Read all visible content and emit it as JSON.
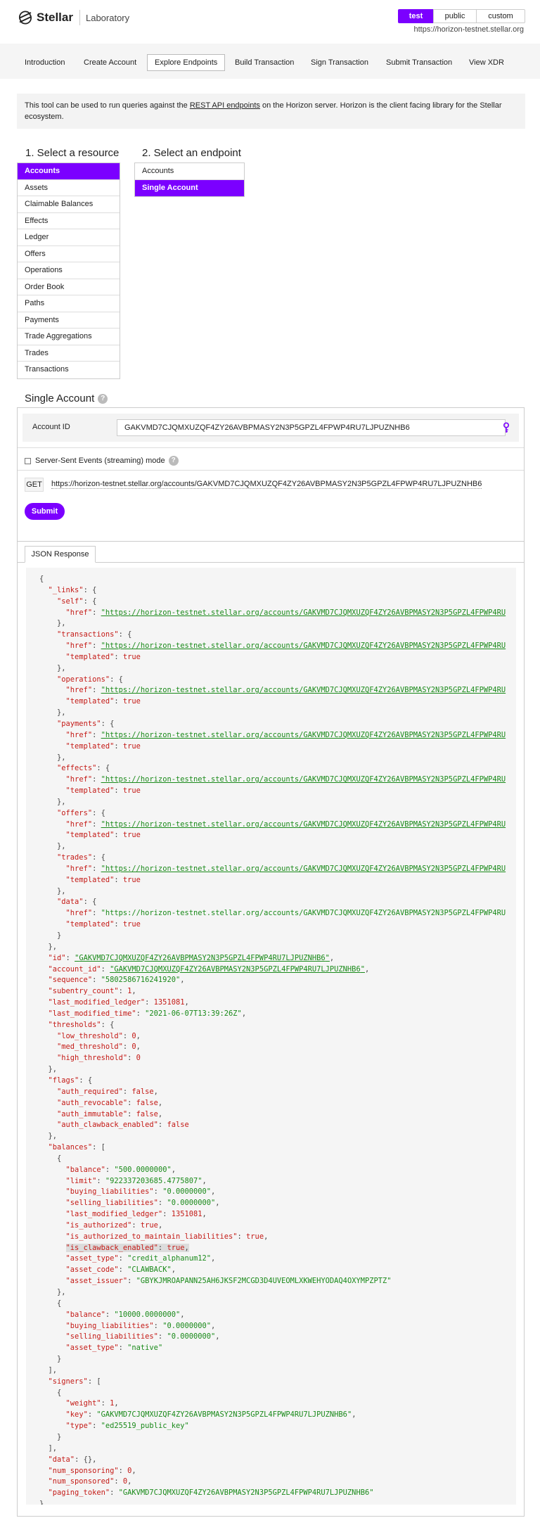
{
  "header": {
    "brand": "Stellar",
    "product": "Laboratory",
    "networks": [
      "test",
      "public",
      "custom"
    ],
    "active_network": "test",
    "horizon_url": "https://horizon-testnet.stellar.org"
  },
  "nav": {
    "items": [
      "Introduction",
      "Create Account",
      "Explore Endpoints",
      "Build Transaction",
      "Sign Transaction",
      "Submit Transaction",
      "View XDR"
    ],
    "active": "Explore Endpoints"
  },
  "intro": {
    "before": "This tool can be used to run queries against the ",
    "link": "REST API endpoints",
    "after": " on the Horizon server. Horizon is the client facing library for the Stellar ecosystem."
  },
  "resources": {
    "title": "1. Select a resource",
    "items": [
      "Accounts",
      "Assets",
      "Claimable Balances",
      "Effects",
      "Ledger",
      "Offers",
      "Operations",
      "Order Book",
      "Paths",
      "Payments",
      "Trade Aggregations",
      "Trades",
      "Transactions"
    ],
    "selected": "Accounts"
  },
  "endpoints": {
    "title": "2. Select an endpoint",
    "items": [
      "Accounts",
      "Single Account"
    ],
    "selected": "Single Account"
  },
  "single_account": {
    "title": "Single Account",
    "help": "?",
    "account_id_label": "Account ID",
    "account_id_value": "GAKVMD7CJQMXUZQF4ZY26AVBPMASY2N3P5GPZL4FPWP4RU7LJPUZNHB6",
    "sse_label": "Server-Sent Events (streaming) mode",
    "method": "GET",
    "request_url": "https://horizon-testnet.stellar.org/accounts/GAKVMD7CJQMXUZQF4ZY26AVBPMASY2N3P5GPZL4FPWP4RU7LJPUZNHB6",
    "submit_label": "Submit"
  },
  "response": {
    "tab_label": "JSON Response",
    "link_base": "https://horizon-testnet.stellar.org/accounts/GAKVMD7CJQMXUZQF4ZY26AVBPMASY2N3P5GPZL4FPWP4RU",
    "data_link": "https://horizon-testnet.stellar.org/accounts/GAKVMD7CJQMXUZQF4ZY26AVBPMASY2N3P5GPZL4FPWP4RU",
    "links": [
      "self",
      "transactions",
      "operations",
      "payments",
      "effects",
      "offers",
      "trades",
      "data"
    ],
    "id": "GAKVMD7CJQMXUZQF4ZY26AVBPMASY2N3P5GPZL4FPWP4RU7LJPUZNHB6",
    "sequence": "5802586716241920",
    "subentry_count": "1",
    "last_modified_ledger": "1351081",
    "last_modified_time": "2021-06-07T13:39:26Z",
    "thresholds": {
      "low_threshold": "0",
      "med_threshold": "0",
      "high_threshold": "0"
    },
    "flags": {
      "auth_required": "false",
      "auth_revocable": "false",
      "auth_immutable": "false",
      "auth_clawback_enabled": "false"
    },
    "balance_1": {
      "balance": "500.0000000",
      "limit": "922337203685.4775807",
      "buying_liabilities": "0.0000000",
      "selling_liabilities": "0.0000000",
      "last_modified_ledger": "1351081",
      "is_authorized": "true",
      "is_authorized_to_maintain_liabilities": "true",
      "is_clawback_enabled": "true",
      "asset_type": "credit_alphanum12",
      "asset_code": "CLAWBACK",
      "asset_issuer": "GBYKJMROAPANN25AH6JKSF2MCGD3D4UVEOMLXKWEHYODAQ4OXYMPZPTZ"
    },
    "balance_2": {
      "balance": "10000.0000000",
      "buying_liabilities": "0.0000000",
      "selling_liabilities": "0.0000000",
      "asset_type": "native"
    },
    "signer": {
      "weight": "1",
      "key": "GAKVMD7CJQMXUZQF4ZY26AVBPMASY2N3P5GPZL4FPWP4RU7LJPUZNHB6",
      "type": "ed25519_public_key"
    },
    "data": "{}",
    "num_sponsoring": "0",
    "num_sponsored": "0",
    "paging_token": "GAKVMD7CJQMXUZQF4ZY26AVBPMASY2N3P5GPZL4FPWP4RU7LJPUZNHB6"
  },
  "colors": {
    "accent": "#7b00ff",
    "json_key": "#c41a16",
    "json_string": "#1a8a1a"
  }
}
